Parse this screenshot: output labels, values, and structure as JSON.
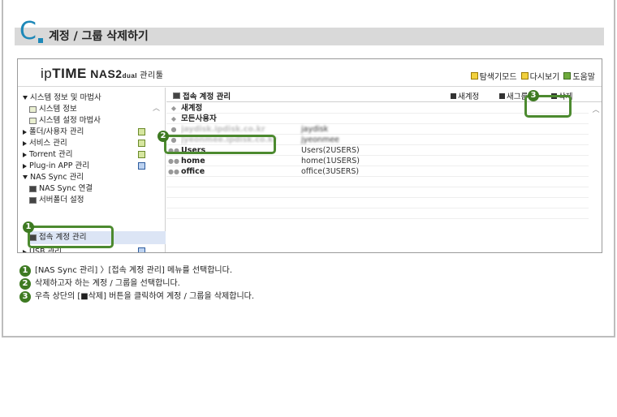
{
  "section": {
    "letter": "C",
    "title": "계정 / 그룹 삭제하기"
  },
  "app": {
    "logo_ip": "ip",
    "logo_time": "TIME",
    "logo_nas": " NAS2",
    "logo_dual": "dual",
    "logo_tool": " 관리툴"
  },
  "top_links": [
    {
      "label": "탐색기모드",
      "icon": "explorer-icon"
    },
    {
      "label": "다시보기",
      "icon": "refresh-icon"
    },
    {
      "label": "도움말",
      "icon": "help-icon"
    }
  ],
  "sidebar": {
    "items": [
      {
        "label": "시스템 정보 및 마법사",
        "kind": "folder-open"
      },
      {
        "label": "시스템 정보",
        "kind": "leaf"
      },
      {
        "label": "시스템 설정 마법사",
        "kind": "leaf"
      },
      {
        "label": "폴더/사용자 관리",
        "kind": "folder-closed"
      },
      {
        "label": "서비스 관리",
        "kind": "folder-closed"
      },
      {
        "label": "Torrent 관리",
        "kind": "folder-closed"
      },
      {
        "label": "Plug-in APP 관리",
        "kind": "folder-closed"
      },
      {
        "label": "NAS Sync 관리",
        "kind": "folder-open"
      },
      {
        "label": "NAS Sync 연결",
        "kind": "leaf"
      },
      {
        "label": "서버폴더 설정",
        "kind": "leaf"
      },
      {
        "label": "접속 계정 관리",
        "kind": "leaf-selected"
      },
      {
        "label": "USB 관리",
        "kind": "folder-closed"
      }
    ]
  },
  "main": {
    "title": "접속 계정 관리",
    "new_account": "새계정",
    "new_group": "새그룹",
    "delete": "삭제",
    "rows": [
      {
        "name": "새계정",
        "value": "",
        "style": "header"
      },
      {
        "name": "모든사용자",
        "value": "",
        "style": "header"
      },
      {
        "name": "jaydisk.ipdisk.co.kr",
        "value": "jaydisk",
        "style": "blur"
      },
      {
        "name": "jyeonmee.ipdisk.co.kr",
        "value": "jyeonmee",
        "style": "blur"
      },
      {
        "name": "Users",
        "value": "Users(2USERS)",
        "style": "group"
      },
      {
        "name": "home",
        "value": "home(1USERS)",
        "style": "group"
      },
      {
        "name": "office",
        "value": "office(3USERS)",
        "style": "group-muted"
      }
    ]
  },
  "steps": [
    {
      "num": "1",
      "text": "[NAS Sync 관리] 〉[접속 계정 관리] 메뉴를 선택합니다."
    },
    {
      "num": "2",
      "text": "삭제하고자 하는 계정 / 그룹을 선택합니다."
    },
    {
      "num": "3",
      "text": "우측 상단의 [■삭제] 버튼을 클릭하여 계정 / 그룹을 삭제합니다."
    }
  ],
  "colors": {
    "accent": "#1d88b8",
    "highlight": "#4c8a2f",
    "bar": "#d9d9d9"
  }
}
